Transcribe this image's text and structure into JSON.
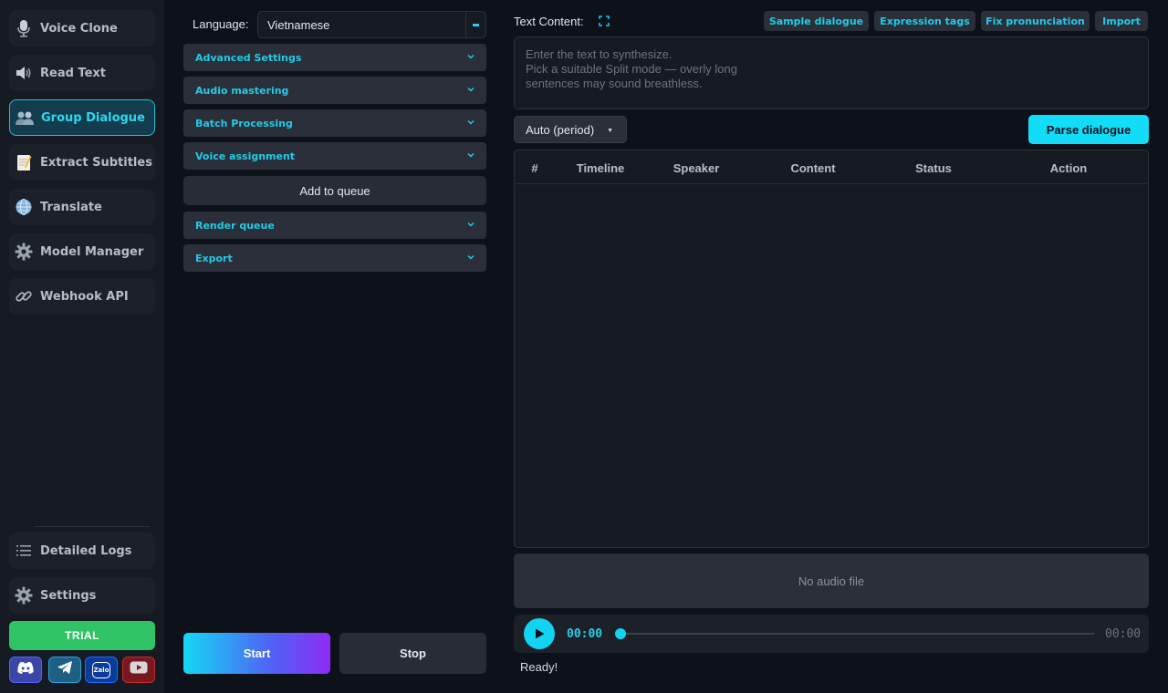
{
  "sidebar": {
    "items": [
      {
        "label": "Voice Clone",
        "icon": "microphone-icon",
        "active": false
      },
      {
        "label": "Read Text",
        "icon": "speaker-icon",
        "active": false
      },
      {
        "label": "Group Dialogue",
        "icon": "users-icon",
        "active": true
      },
      {
        "label": "Extract Subtitles",
        "icon": "memo-icon",
        "active": false
      },
      {
        "label": "Translate",
        "icon": "globe-icon",
        "active": false
      },
      {
        "label": "Model Manager",
        "icon": "gear-icon",
        "active": false
      },
      {
        "label": "Webhook API",
        "icon": "link-icon",
        "active": false
      }
    ],
    "bottom_items": [
      {
        "label": "Detailed Logs",
        "icon": "list-icon"
      },
      {
        "label": "Settings",
        "icon": "gear-icon"
      }
    ],
    "trial_label": "TRIAL",
    "social": [
      {
        "icon": "discord-icon",
        "color": "#5865f2"
      },
      {
        "icon": "telegram-icon",
        "color": "#2aa3df"
      },
      {
        "icon": "zalo-icon",
        "color": "#0a68ff",
        "text": "Zalo"
      },
      {
        "icon": "youtube-icon",
        "color": "#e62117"
      }
    ]
  },
  "settings_panel": {
    "language_label": "Language:",
    "language_value": "Vietnamese",
    "sections": [
      {
        "label": "Advanced Settings"
      },
      {
        "label": "Audio mastering"
      },
      {
        "label": "Batch Processing"
      },
      {
        "label": "Voice assignment"
      }
    ],
    "add_to_queue_label": "Add to queue",
    "sections_after": [
      {
        "label": "Render queue"
      },
      {
        "label": "Export"
      }
    ],
    "start_label": "Start",
    "stop_label": "Stop"
  },
  "editor": {
    "text_content_label": "Text Content:",
    "toolbar": {
      "sample_dialogue": "Sample dialogue",
      "expression_tags": "Expression tags",
      "fix_pronunciation": "Fix pronunciation",
      "import": "Import"
    },
    "placeholder_lines": [
      "Enter the text to synthesize.",
      "Pick a suitable Split mode — overly long",
      "sentences may sound breathless."
    ],
    "split_mode": "Auto (period)",
    "parse_label": "Parse dialogue",
    "table_headers": [
      "#",
      "Timeline",
      "Speaker",
      "Content",
      "Status",
      "Action"
    ],
    "table_rows": []
  },
  "player": {
    "no_audio_text": "No audio file",
    "current_time": "00:00",
    "total_time": "00:00",
    "progress": 0
  },
  "status": "Ready!",
  "colors": {
    "accent": "#12d4f2",
    "trial": "#30c466",
    "background": "#0d1119"
  }
}
